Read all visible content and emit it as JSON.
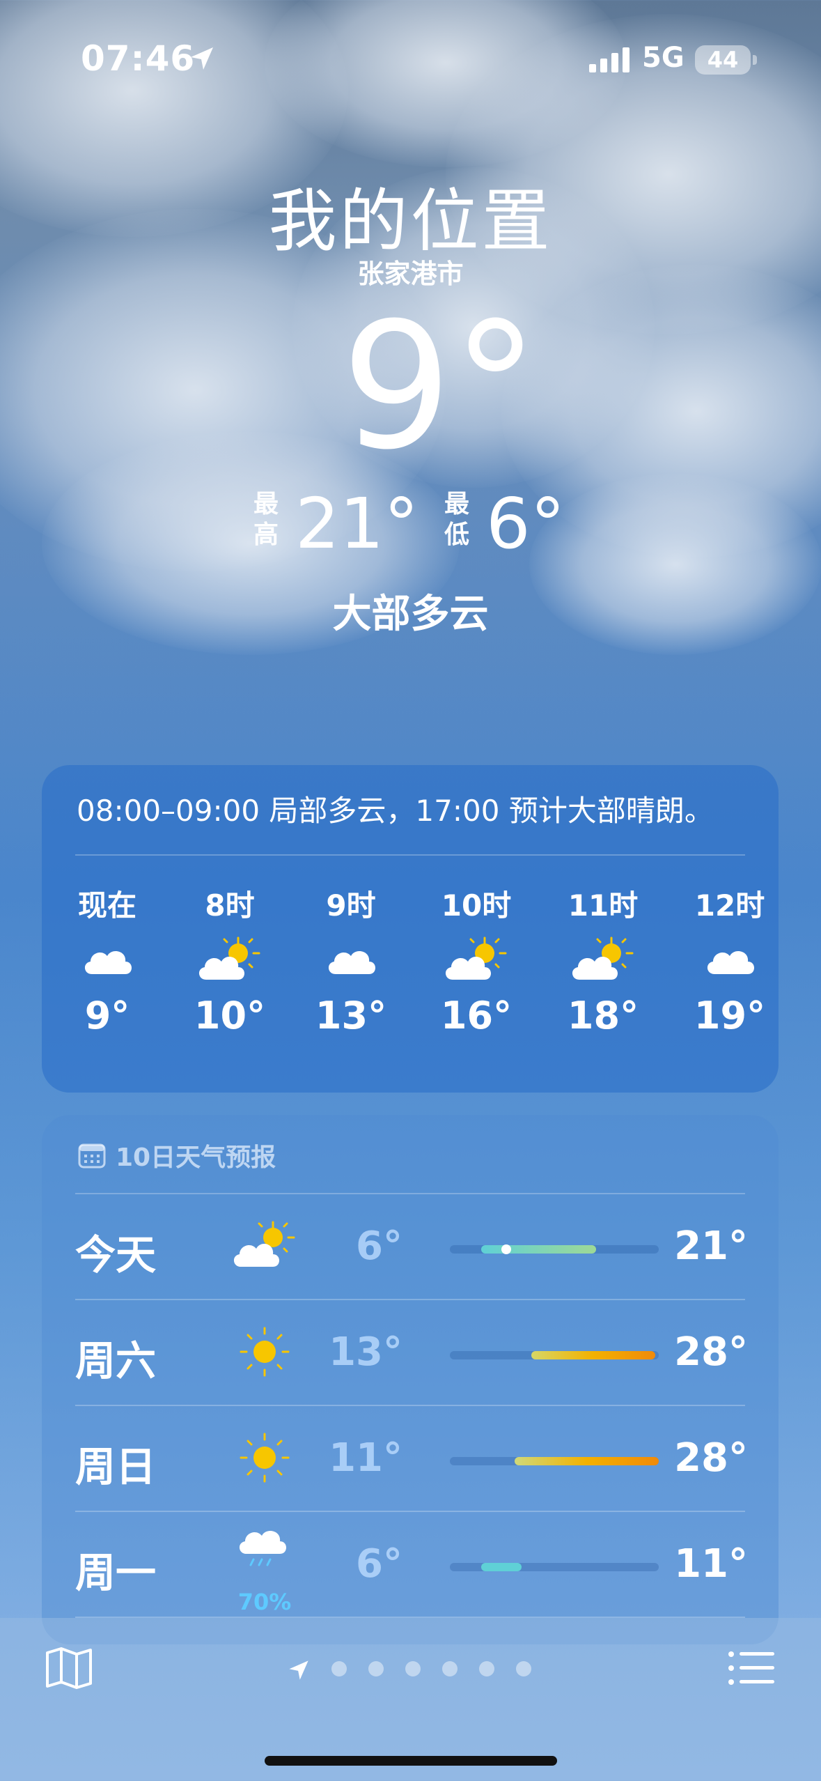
{
  "status_bar": {
    "time": "07:46",
    "network": "5G",
    "battery": "44"
  },
  "header": {
    "title": "我的位置",
    "city": "张家港市",
    "current_temp": "9°",
    "high_label": "最高",
    "high_value": "21°",
    "low_label": "最低",
    "low_value": "6°",
    "condition": "大部多云"
  },
  "hourly": {
    "summary": "08:00–09:00 局部多云，17:00 预计大部晴朗。",
    "items": [
      {
        "label": "现在",
        "icon": "cloud-icon",
        "temp": "9°"
      },
      {
        "label": "8时",
        "icon": "partly-sunny-icon",
        "temp": "10°"
      },
      {
        "label": "9时",
        "icon": "cloud-icon",
        "temp": "13°"
      },
      {
        "label": "10时",
        "icon": "partly-sunny-icon",
        "temp": "16°"
      },
      {
        "label": "11时",
        "icon": "partly-sunny-icon",
        "temp": "18°"
      },
      {
        "label": "12时",
        "icon": "cloud-icon",
        "temp": "19°"
      }
    ]
  },
  "daily": {
    "header": "10日天气预报",
    "days": [
      {
        "day": "今天",
        "icon": "partly-sunny-icon",
        "precip": "",
        "low": "6°",
        "high": "21°",
        "range_start": 0.15,
        "range_end": 0.7,
        "current": 0.27
      },
      {
        "day": "周六",
        "icon": "sun-icon",
        "precip": "",
        "low": "13°",
        "high": "28°",
        "range_start": 0.39,
        "range_end": 1.0
      },
      {
        "day": "周日",
        "icon": "sun-icon",
        "precip": "",
        "low": "11°",
        "high": "28°",
        "range_start": 0.31,
        "range_end": 1.0
      },
      {
        "day": "周一",
        "icon": "rain-icon",
        "precip": "70%",
        "low": "6°",
        "high": "11°",
        "range_start": 0.15,
        "range_end": 0.35
      }
    ]
  },
  "pager": {
    "count": 6,
    "active": 0
  }
}
